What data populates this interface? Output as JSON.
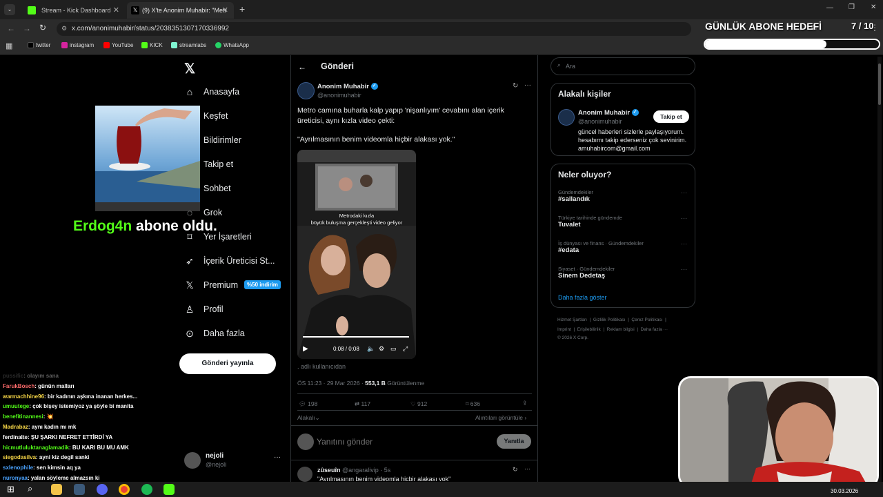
{
  "browser": {
    "tabs": [
      {
        "title": "Stream - Kick Dashboard"
      },
      {
        "title": "(9) X'te Anonim Muhabir: \"Metr"
      }
    ],
    "new_tab": "+",
    "url": "x.com/anonimuhabir/status/2038351307170336992",
    "bookmarks": [
      "twitter",
      "instagram",
      "YouTube",
      "KICK",
      "streamlabs",
      "WhatsApp"
    ]
  },
  "overlay": {
    "goal_title": "GÜNLÜK ABONE HEDEFİ",
    "goal_count": "7 / 10",
    "goal_progress": 0.7,
    "sub_user": "Erdog4n",
    "sub_text": "abone oldu."
  },
  "x_nav": {
    "items": [
      "Anasayfa",
      "Keşfet",
      "Bildirimler",
      "Takip et",
      "Sohbet",
      "Grok",
      "Yer İşaretleri",
      "İçerik Üreticisi St...",
      "Premium",
      "Profil",
      "Daha fazla"
    ],
    "premium_badge": "%50 indirim",
    "post_button": "Gönderi yayınla",
    "account_name": "nejoli",
    "account_handle": "@nejoli"
  },
  "post": {
    "header": "Gönderi",
    "author": "Anonim Muhabir",
    "handle": "@anonimuhabir",
    "text1": "Metro camına buharla kalp yapıp 'nişanlıyım' cevabını alan içerik üreticisi, aynı kızla video çekti:",
    "text2": "\"Ayrılmasının benim videomla hiçbir alakası yok.\"",
    "video_caption1": "Metrodaki kızla",
    "video_caption2": "büyük buluşma gerçekleşti video geliyor",
    "video_time": "0:08 / 0:08",
    "source": ". adlı kullanıcıdan",
    "timestamp": "ÖS 11:23 · 29 Mar 2026 · ",
    "views": "553,1 B",
    "views_label": "Görüntülenme",
    "replies": "198",
    "reposts": "117",
    "likes": "912",
    "bookmarks": "636",
    "relevant": "Alakalı",
    "quotes": "Alıntıları görüntüle",
    "reply_placeholder": "Yanıtını gönder",
    "reply_button": "Yanıtla"
  },
  "reply": {
    "author": "zûseuîn",
    "handle": "@angaralivip · 5s",
    "text": "\"Ayrılmasının benim videomla hiçbir alakası yok\""
  },
  "sidebar": {
    "search_placeholder": "Ara",
    "relevant_title": "Alakalı kişiler",
    "person_name": "Anonim Muhabir",
    "person_handle": "@anonimuhabir",
    "follow_button": "Takip et",
    "person_bio": "güncel haberleri sizlerle paylaşıyorum. hesabımı takip ederseniz çok sevinirim. amuhabircom@gmail.com",
    "trends_title": "Neler oluyor?",
    "trends": [
      {
        "category": "Gündemdekiler",
        "name": "#sallandık"
      },
      {
        "category": "Türkiye tarihinde gündemde",
        "name": "Tuvalet"
      },
      {
        "category": "İş dünyası ve finans · Gündemdekiler",
        "name": "#edata"
      },
      {
        "category": "Siyaset · Gündemdekiler",
        "name": "Sinem Dedetaş"
      }
    ],
    "show_more": "Daha fazla göster",
    "footer1": "Hizmet Şartları  |  Gizlilik Politikası  |  Çerez Politikası  |",
    "footer2": "Imprint  |  Erişilebilirlik  |  Reklam bilgisi  |  Daha fazla ···",
    "footer3": "© 2026 X Corp."
  },
  "chat": [
    {
      "user": "pussific",
      "msg": ": olayım sana",
      "color": "#777777"
    },
    {
      "user": "FarukBosch",
      "msg": ": günün malları",
      "color": "#ff6b6b"
    },
    {
      "user": "warmachhine96",
      "msg": ": bir kadının aşkına inanan herkes...",
      "color": "#f5d547"
    },
    {
      "user": "umuutege",
      "msg": ": çok bişey istemiyoz ya şöyle bi manita",
      "color": "#53fc18"
    },
    {
      "user": "benefitinannesi",
      "msg": ": 💥",
      "color": "#53fc18"
    },
    {
      "user": "Madrabaz",
      "msg": ": aynı kadın mı mk",
      "color": "#f5d547"
    },
    {
      "user": "ferdinalte",
      "msg": ": ŞU ŞARKI NEFRET ETTİRDİ YA",
      "color": "#ffffff"
    },
    {
      "user": "hicmutluluktanaglamadik",
      "msg": ": BU KARI BU MU AMK",
      "color": "#53fc18"
    },
    {
      "user": "siegodasilva",
      "msg": ": ayni kiz degil sanki",
      "color": "#f5d547"
    },
    {
      "user": "sxlenophile",
      "msg": ": sen kimsin aq ya",
      "color": "#4aa3ff"
    },
    {
      "user": "nuronyaa",
      "msg": ": yalan söyleme almazsın ki",
      "color": "#4aa3ff"
    }
  ],
  "taskbar": {
    "date": "30.03.2026"
  },
  "colors": {
    "accent_blue": "#1d9bf0",
    "kick_green": "#53fc18"
  }
}
